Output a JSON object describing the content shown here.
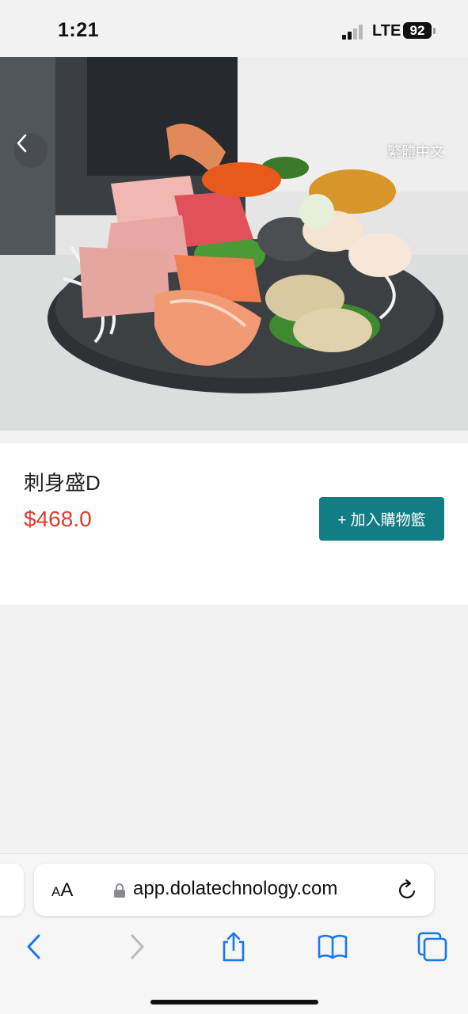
{
  "status": {
    "time": "1:21",
    "network": "LTE",
    "battery": "92"
  },
  "header": {
    "language_label": "繁體中文"
  },
  "product": {
    "name": "刺身盛D",
    "price": "$468.0",
    "add_to_cart_label": "+ 加入購物籃"
  },
  "browser": {
    "aa_big": "A",
    "aa_small": "A",
    "url": "app.dolatechnology.com"
  },
  "colors": {
    "accent": "#127d84",
    "price": "#e23a2e",
    "ios_blue": "#1877f2"
  },
  "icons": [
    "back-chevron-icon",
    "lock-icon",
    "reload-icon",
    "nav-back-icon",
    "nav-forward-icon",
    "share-icon",
    "bookmarks-icon",
    "tabs-icon"
  ]
}
